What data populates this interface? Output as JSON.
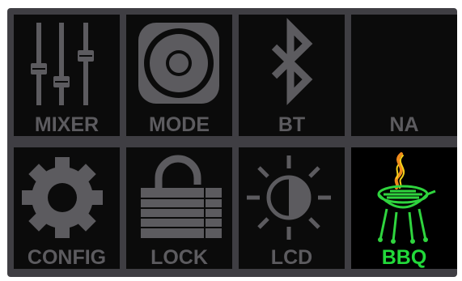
{
  "tiles": [
    {
      "id": "mixer",
      "label": "MIXER",
      "icon": "sliders-icon",
      "selected": false
    },
    {
      "id": "mode",
      "label": "MODE",
      "icon": "speaker-icon",
      "selected": false
    },
    {
      "id": "bt",
      "label": "BT",
      "icon": "bluetooth-icon",
      "selected": false
    },
    {
      "id": "na",
      "label": "NA",
      "icon": "",
      "selected": false
    },
    {
      "id": "config",
      "label": "CONFIG",
      "icon": "gear-icon",
      "selected": false
    },
    {
      "id": "lock",
      "label": "LOCK",
      "icon": "padlock-icon",
      "selected": false
    },
    {
      "id": "lcd",
      "label": "LCD",
      "icon": "brightness-icon",
      "selected": false
    },
    {
      "id": "bbq",
      "label": "BBQ",
      "icon": "grill-icon",
      "selected": true
    }
  ],
  "colors": {
    "panel": "#3f3e43",
    "tile": "#0b0b0b",
    "icon": "#5c5b5f",
    "label": "#5c5b5f",
    "selected_label": "#22d93a",
    "flame_yellow": "#f5d21a",
    "flame_orange": "#f08a1c"
  }
}
